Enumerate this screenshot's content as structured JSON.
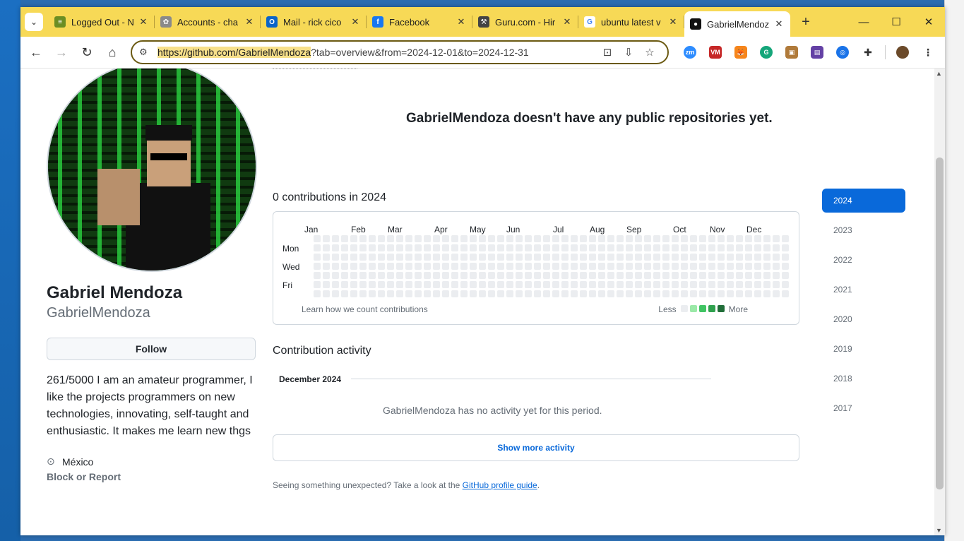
{
  "browser": {
    "tabs": [
      {
        "title": "Logged Out - N",
        "icon": "stripes-icon"
      },
      {
        "title": "Accounts - cha",
        "icon": "gear-icon"
      },
      {
        "title": "Mail - rick cico",
        "icon": "outlook-icon"
      },
      {
        "title": "Facebook",
        "icon": "facebook-icon"
      },
      {
        "title": "Guru.com - Hir",
        "icon": "guru-icon"
      },
      {
        "title": "ubuntu latest v",
        "icon": "google-icon"
      },
      {
        "title": "GabrielMendoz",
        "icon": "github-icon",
        "active": true
      }
    ],
    "url_highlight": "https://github.com/GabrielMendoza",
    "url_rest": "?tab=overview&from=2024-12-01&to=2024-12-31"
  },
  "profile": {
    "name": "Gabriel Mendoza",
    "login": "GabrielMendoza",
    "follow_label": "Follow",
    "bio": "261/5000 I am an amateur programmer, I like the projects programmers on new technologies, innovating, self-taught and enthusiastic. It makes me learn new thgs",
    "location": "México",
    "block_label": "Block or Report"
  },
  "main": {
    "no_repos": "GabrielMendoza doesn't have any public repositories yet.",
    "contrib_title": "0 contributions in 2024",
    "months": [
      "Jan",
      "Feb",
      "Mar",
      "Apr",
      "May",
      "Jun",
      "Jul",
      "Aug",
      "Sep",
      "Oct",
      "Nov",
      "Dec"
    ],
    "day_labels": [
      "Mon",
      "Wed",
      "Fri"
    ],
    "learn_link": "Learn how we count contributions",
    "legend_less": "Less",
    "legend_more": "More",
    "legend_colors": [
      "#ebedf0",
      "#9be9a8",
      "#40c463",
      "#30a14e",
      "#216e39"
    ],
    "cell_color": "#ebedf0",
    "activity_title": "Contribution activity",
    "month_header": "December 2024",
    "no_activity": "GabrielMendoza has no activity yet for this period.",
    "show_more": "Show more activity",
    "unexpected_prefix": "Seeing something unexpected? Take a look at the ",
    "guide_link": "GitHub profile guide",
    "unexpected_suffix": "."
  },
  "years": [
    "2024",
    "2023",
    "2022",
    "2021",
    "2020",
    "2019",
    "2018",
    "2017"
  ],
  "active_year": "2024"
}
